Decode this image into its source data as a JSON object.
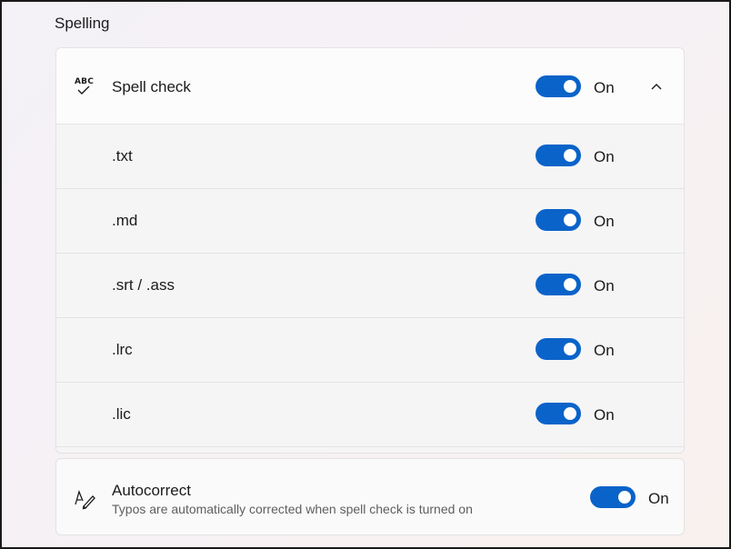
{
  "section": {
    "title": "Spelling"
  },
  "spell_check": {
    "label": "Spell check",
    "icon": "spell-check-icon",
    "icon_text": "ABC",
    "state": "On",
    "expanded": true,
    "file_types": [
      {
        "label": ".txt",
        "state": "On"
      },
      {
        "label": ".md",
        "state": "On"
      },
      {
        "label": ".srt / .ass",
        "state": "On"
      },
      {
        "label": ".lrc",
        "state": "On"
      },
      {
        "label": ".lic",
        "state": "On"
      }
    ]
  },
  "autocorrect": {
    "label": "Autocorrect",
    "description": "Typos are automatically corrected when spell check is turned on",
    "icon": "autocorrect-pen-icon",
    "state": "On"
  },
  "colors": {
    "accent": "#0a63c9"
  }
}
